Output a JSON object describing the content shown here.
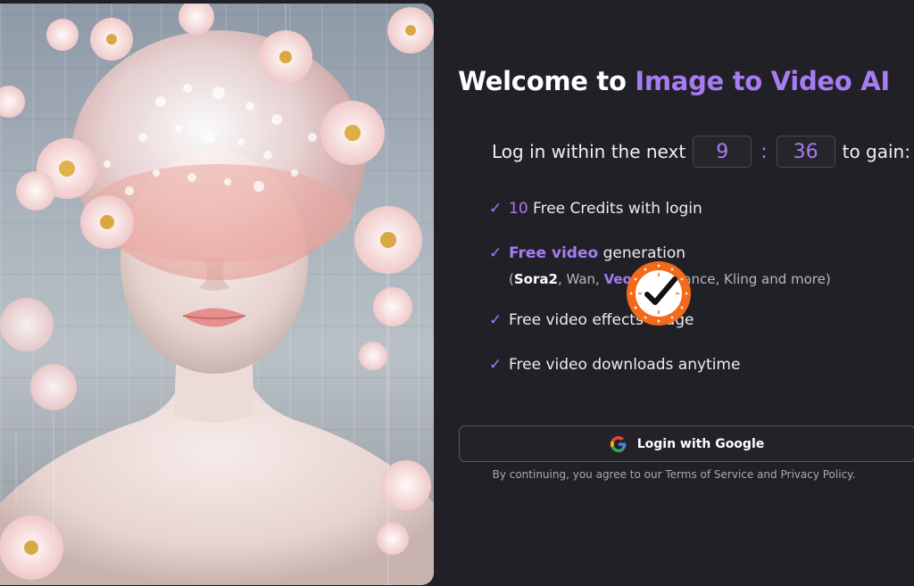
{
  "welcome": {
    "prefix": "Welcome to ",
    "brand": "Image to Video AI"
  },
  "timer": {
    "before": "Log in within the next",
    "minutes": "9",
    "separator": ":",
    "seconds": "36",
    "after": "to gain:"
  },
  "benefits": [
    {
      "check": "✓",
      "highlight": "10",
      "text": " Free Credits with login"
    },
    {
      "check": "✓",
      "highlight": "Free video",
      "text": " generation"
    },
    {
      "check": "✓",
      "highlight": "",
      "text": "Free video effects usage"
    },
    {
      "check": "✓",
      "highlight": "",
      "text": "Free video downloads anytime"
    }
  ],
  "models": {
    "open": "(",
    "sora": "Sora2",
    "wan": ", Wan, ",
    "veo": "Veo3",
    "rest": ", Seedance, Kling and more)"
  },
  "login": {
    "label": "Login with Google",
    "icon": "google-icon"
  },
  "terms": {
    "prefix": "By continuing, you agree to our ",
    "tos": "Terms of Service",
    "and": " and ",
    "privacy": "Privacy Policy",
    "suffix": "."
  },
  "overlay": {
    "icon": "checkmark-badge-icon",
    "color": "#f26a1b"
  },
  "colors": {
    "accent": "#a77bf1",
    "background": "#222027"
  }
}
